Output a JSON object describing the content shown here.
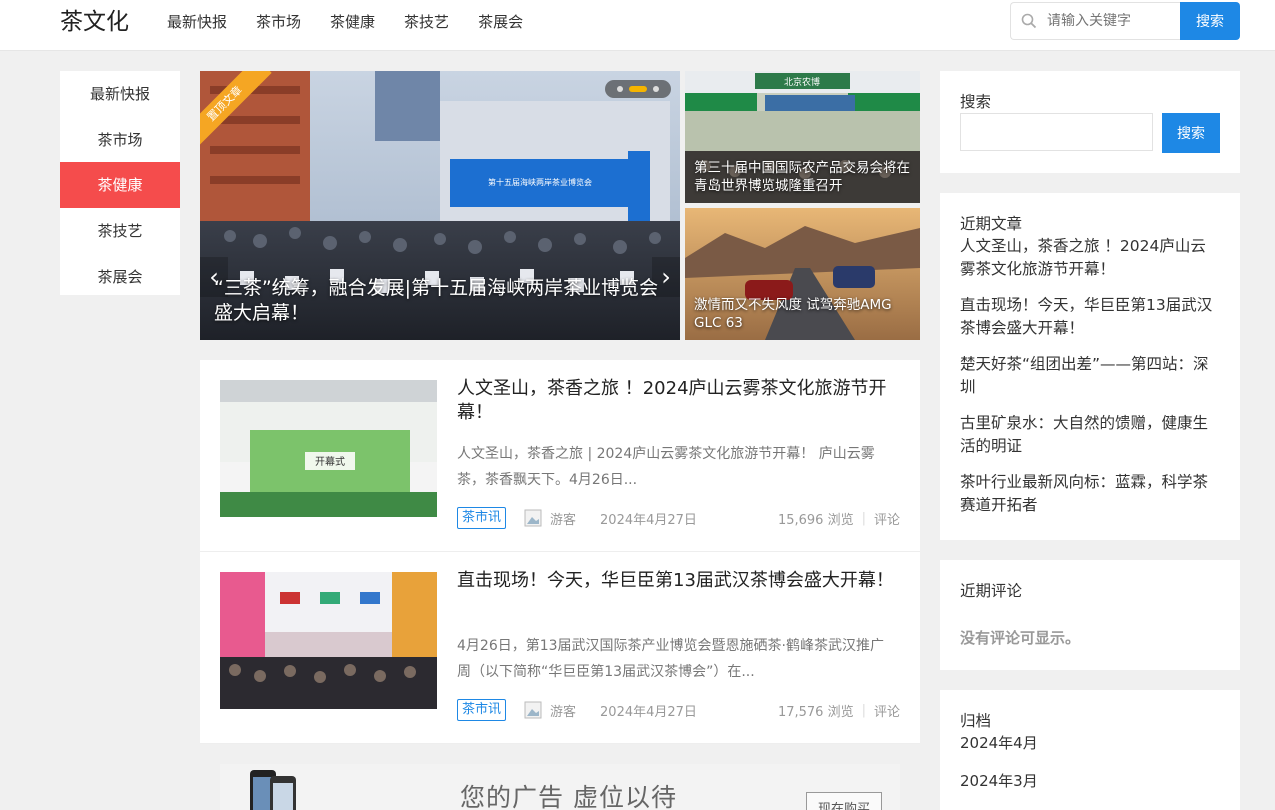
{
  "header": {
    "logo": "茶文化",
    "nav": [
      "最新快报",
      "茶市场",
      "茶健康",
      "茶技艺",
      "茶展会"
    ],
    "search_placeholder": "请输入关键字",
    "search_button": "搜索"
  },
  "left_menu": {
    "items": [
      "最新快报",
      "茶市场",
      "茶健康",
      "茶技艺",
      "茶展会"
    ],
    "active_index": 2
  },
  "slider": {
    "ribbon": "置顶文章",
    "caption": "“三茶”统筹，融合发展|第十五届海峡两岸茶业博览会盛大启幕！",
    "banner_text": "第十五届海峡两岸茶业博览会",
    "prev": "‹",
    "next": "›",
    "dots": 3,
    "active_dot": 1
  },
  "side_tiles": [
    {
      "caption": "第三十届中国国际农产品交易会将在青岛世界博览城隆重召开",
      "sign_text": "北京农博"
    },
    {
      "caption": "激情而又不失风度 试驾奔驰AMG GLC 63"
    }
  ],
  "posts": [
    {
      "title": "人文圣山，茶香之旅 ！2024庐山云雾茶文化旅游节开幕！",
      "excerpt": "人文圣山，茶香之旅 | 2024庐山云雾茶文化旅游节开幕！          庐山云雾茶，茶香飘天下。4月26日...",
      "tag": "茶市讯",
      "author": "游客",
      "date": "2024年4月27日",
      "views": "15,696 浏览",
      "comments": "评论",
      "thumb_text": "开幕式"
    },
    {
      "title": "直击现场！今天，华巨臣第13届武汉茶博会盛大开幕！",
      "excerpt": "4月26日，第13届武汉国际茶产业博览会暨恩施硒茶·鹤峰茶武汉推广周（以下简称“华巨臣第13届武汉茶博会”）在...",
      "tag": "茶市讯",
      "author": "游客",
      "date": "2024年4月27日",
      "views": "17,576 浏览",
      "comments": "评论"
    }
  ],
  "ad": {
    "text": "您的广告 虚位以待",
    "button": "现在购买"
  },
  "sidebar": {
    "search": {
      "title": "搜索",
      "button": "搜索"
    },
    "recent_posts": {
      "title": "近期文章",
      "items": [
        "人文圣山，茶香之旅 ！2024庐山云雾茶文化旅游节开幕！",
        "直击现场！今天，华巨臣第13届武汉茶博会盛大开幕！",
        "楚天好茶“组团出差”——第四站：深圳",
        "古里矿泉水：大自然的馈赠，健康生活的明证",
        "茶叶行业最新风向标：蓝霖，科学茶赛道开拓者"
      ]
    },
    "recent_comments": {
      "title": "近期评论",
      "empty": "没有评论可显示。"
    },
    "archives": {
      "title": "归档",
      "items": [
        "2024年4月",
        "2024年3月"
      ]
    }
  },
  "colors": {
    "accent": "#1e88e5",
    "active_menu": "#f54c4c",
    "ribbon": "#f5a623"
  }
}
